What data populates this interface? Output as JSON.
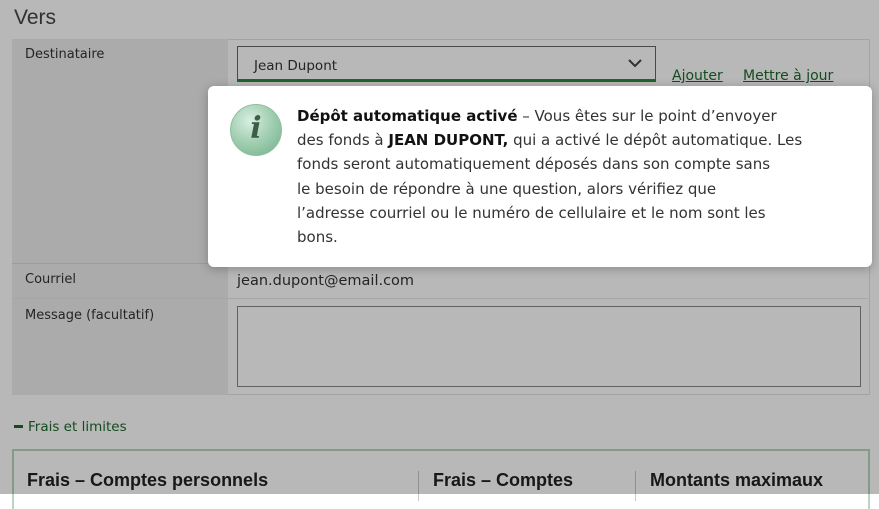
{
  "section_title": "Vers",
  "form": {
    "recipient_label": "Destinataire",
    "recipient_value": "Jean Dupont",
    "add_link": "Ajouter",
    "update_link": "Mettre à jour",
    "email_label": "Courriel",
    "email_value": "jean.dupont@email.com",
    "message_label": "Message (facultatif)",
    "message_value": ""
  },
  "tooltip": {
    "title": "Dépôt automatique activé",
    "t1": " – Vous êtes sur le point d’envoyer",
    "t2": "des fonds à ",
    "name": "JEAN DUPONT,",
    "t3": " qui a activé le dépôt automatique. Les",
    "t4": "fonds seront automatiquement déposés dans son compte sans",
    "t5": "le besoin de répondre à une question, alors vérifiez que",
    "t6": "l’adresse courriel ou le numéro de cellulaire et le nom sont les",
    "t7": "bons.",
    "icon": "info-icon"
  },
  "fees": {
    "toggle_label": "Frais et limites",
    "col1": "Frais – Comptes personnels",
    "col2": "Frais – Comptes",
    "col3": "Montants maximaux"
  },
  "colors": {
    "accent_green": "#2f8a3b",
    "link_green": "#1d6a2b"
  }
}
